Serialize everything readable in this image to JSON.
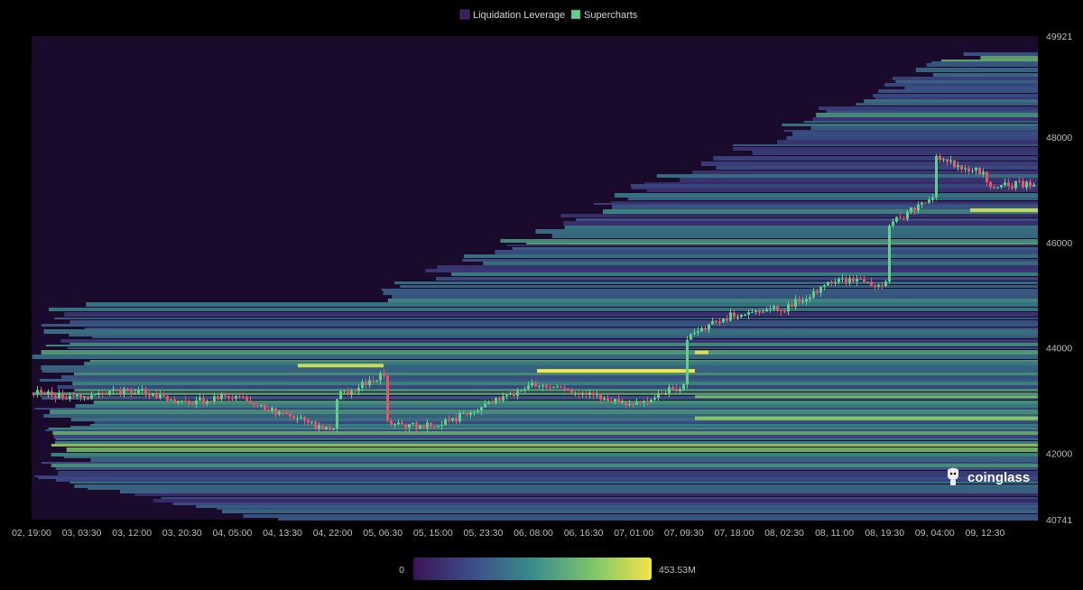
{
  "chart_data": {
    "type": "heatmap",
    "title": "",
    "legend": [
      {
        "name": "Liquidation Leverage",
        "color": "#3a1f5e"
      },
      {
        "name": "Supercharts",
        "color": "#5fcf8a"
      }
    ],
    "legend_placement": "top-center",
    "x_tick_labels": [
      "02, 19:00",
      "03, 03:30",
      "03, 12:00",
      "03, 20:30",
      "04, 05:00",
      "04, 13:30",
      "04, 22:00",
      "05, 06:30",
      "05, 15:00",
      "05, 23:30",
      "06, 08:00",
      "06, 16:30",
      "07, 01:00",
      "07, 09:30",
      "07, 18:00",
      "08, 02:30",
      "08, 11:00",
      "08, 19:30",
      "09, 04:00",
      "09, 12:30"
    ],
    "y_tick_labels": [
      "49921",
      "48000",
      "46000",
      "44000",
      "42000",
      "40741"
    ],
    "ylim": [
      40741,
      49921
    ],
    "colorbar": {
      "min_label": "0",
      "max_label": "453.53M",
      "min": 0,
      "max": 453530000
    },
    "price_path": [
      {
        "x": "02, 19:00",
        "y": 43150
      },
      {
        "x": "03, 03:30",
        "y": 43050
      },
      {
        "x": "03, 12:00",
        "y": 43200
      },
      {
        "x": "03, 20:30",
        "y": 42950
      },
      {
        "x": "04, 05:00",
        "y": 43100
      },
      {
        "x": "04, 13:30",
        "y": 42750
      },
      {
        "x": "04, 22:00",
        "y": 42400
      },
      {
        "x": "04, 22:00",
        "y": 43050
      },
      {
        "x": "05, 06:30",
        "y": 43500
      },
      {
        "x": "05, 06:30",
        "y": 42600
      },
      {
        "x": "05, 15:00",
        "y": 42500
      },
      {
        "x": "05, 23:30",
        "y": 42900
      },
      {
        "x": "06, 08:00",
        "y": 43300
      },
      {
        "x": "06, 16:30",
        "y": 43100
      },
      {
        "x": "07, 01:00",
        "y": 42950
      },
      {
        "x": "07, 09:30",
        "y": 43300
      },
      {
        "x": "07, 09:30",
        "y": 44200
      },
      {
        "x": "07, 18:00",
        "y": 44650
      },
      {
        "x": "08, 02:30",
        "y": 44750
      },
      {
        "x": "08, 11:00",
        "y": 45300
      },
      {
        "x": "08, 19:30",
        "y": 45200
      },
      {
        "x": "08, 19:30",
        "y": 46300
      },
      {
        "x": "09, 04:00",
        "y": 46900
      },
      {
        "x": "09, 04:00",
        "y": 47600
      },
      {
        "x": "09, 12:30",
        "y": 47300
      },
      {
        "x": "09, 12:30",
        "y": 47100
      }
    ]
  },
  "watermark": "coinglass"
}
